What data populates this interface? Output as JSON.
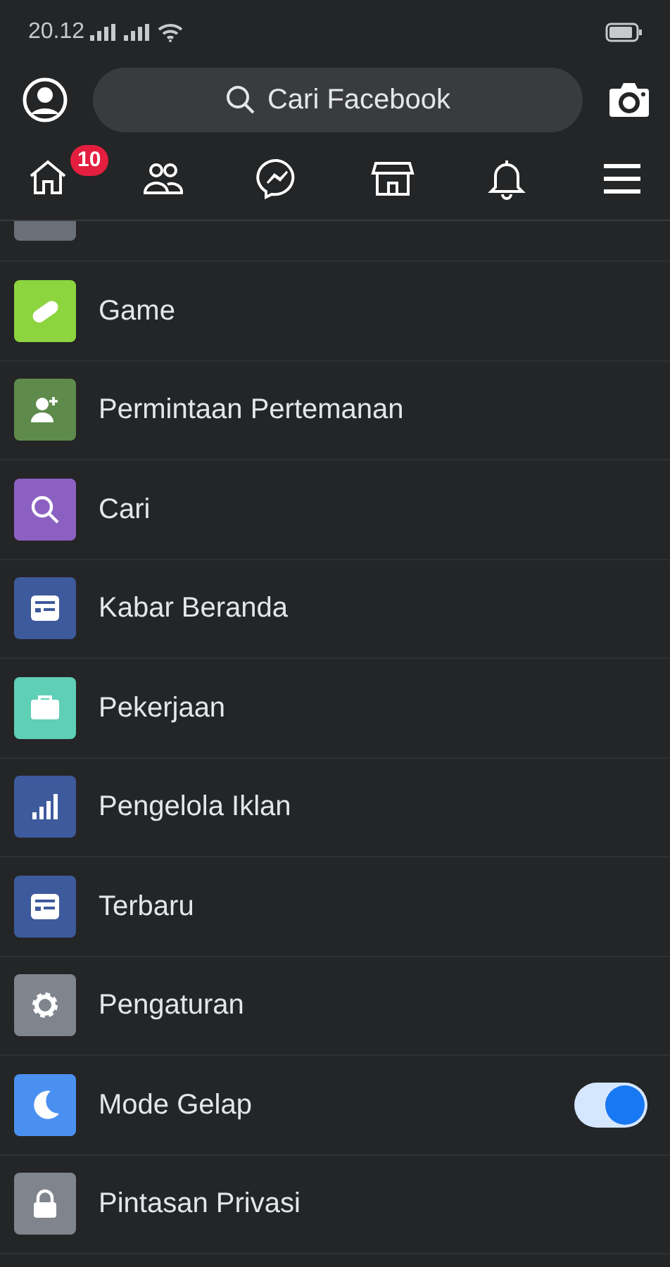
{
  "status_bar": {
    "time": "20.12"
  },
  "search": {
    "placeholder": "Cari Facebook"
  },
  "home_badge": "10",
  "menu_items": [
    {
      "label": "Game",
      "color": "#8cd53f",
      "kind": "link"
    },
    {
      "label": "Permintaan Pertemanan",
      "color": "#5e8a4b",
      "kind": "link"
    },
    {
      "label": "Cari",
      "color": "#8c60c2",
      "kind": "link"
    },
    {
      "label": "Kabar Beranda",
      "color": "#3d5a9c",
      "kind": "link"
    },
    {
      "label": "Pekerjaan",
      "color": "#5fcfb6",
      "kind": "link"
    },
    {
      "label": "Pengelola Iklan",
      "color": "#3d5a9c",
      "kind": "link"
    },
    {
      "label": "Terbaru",
      "color": "#3d5a9c",
      "kind": "link"
    },
    {
      "label": "Pengaturan",
      "color": "#80848c",
      "kind": "link"
    },
    {
      "label": "Mode Gelap",
      "color": "#4a90f0",
      "kind": "toggle",
      "on": true
    },
    {
      "label": "Pintasan Privasi",
      "color": "#80848c",
      "kind": "link"
    }
  ]
}
